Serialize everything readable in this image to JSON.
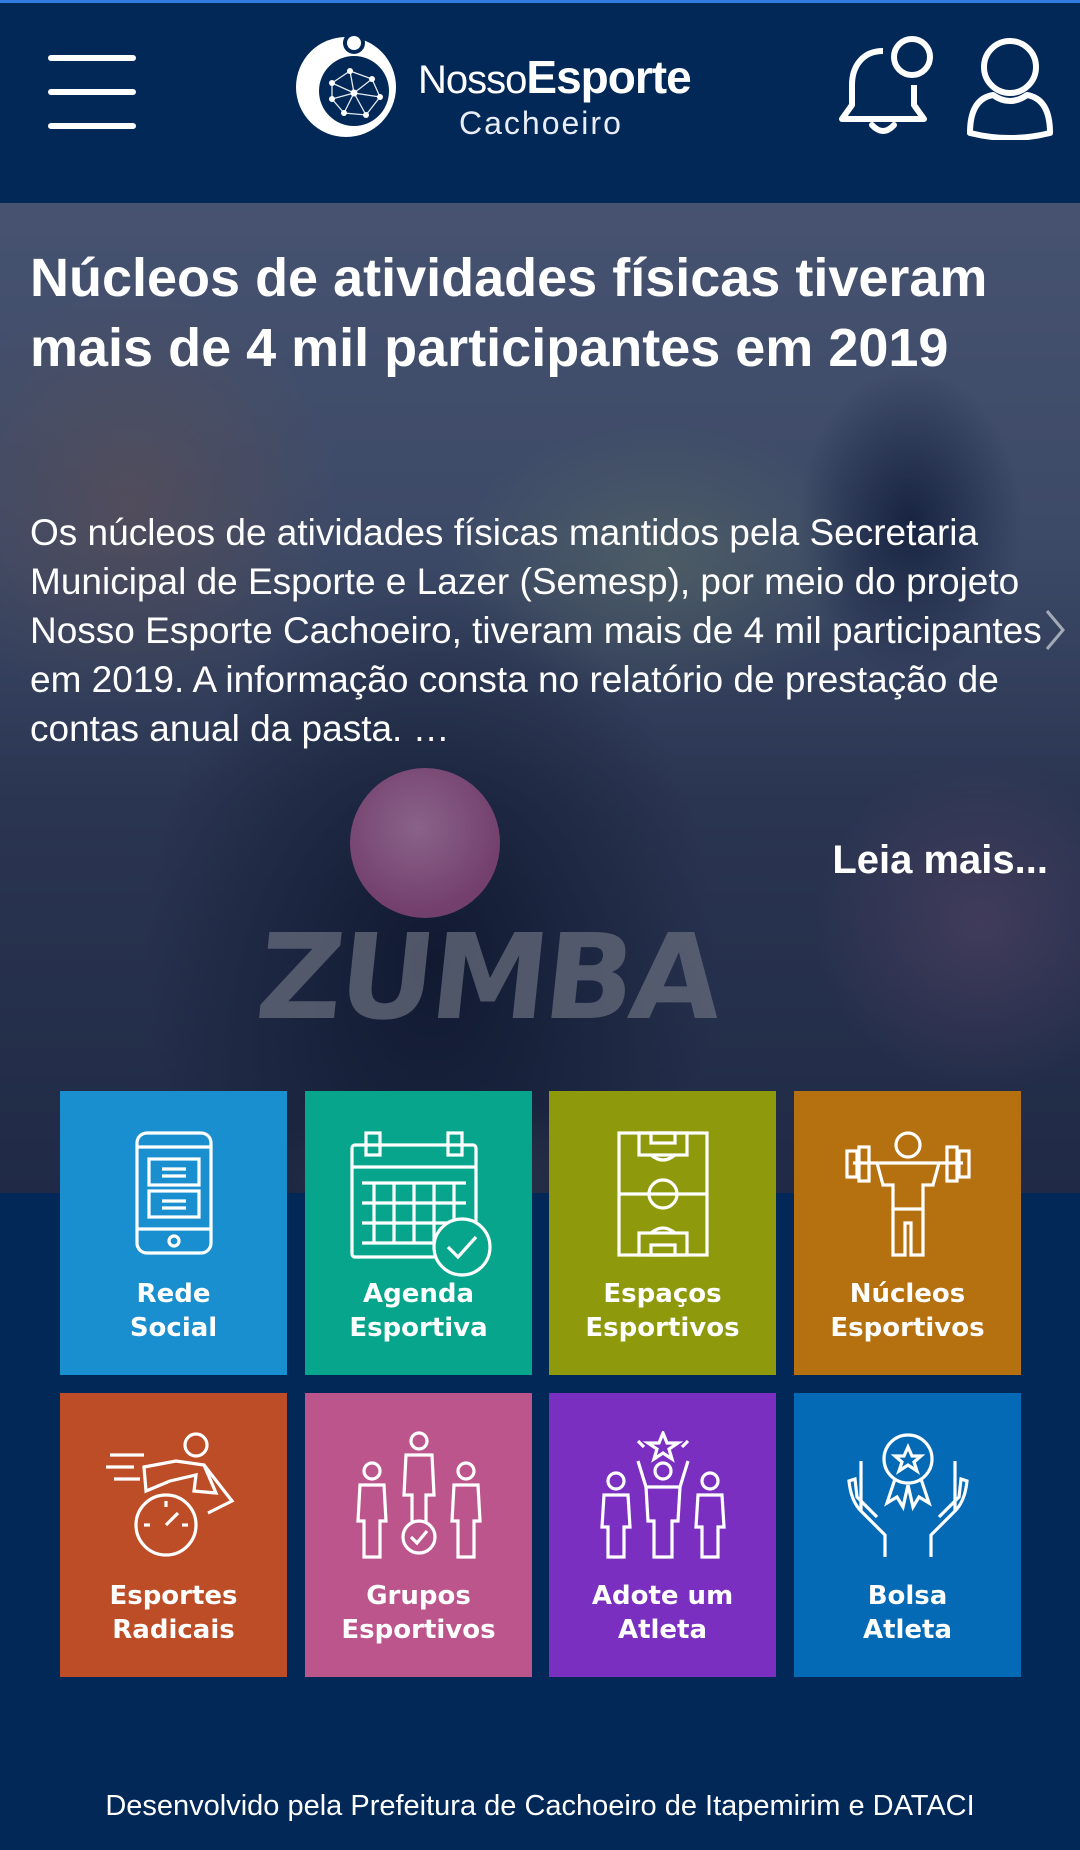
{
  "header": {
    "logo": {
      "line1_light": "Nosso",
      "line1_bold": "Esporte",
      "line2": "Cachoeiro"
    },
    "menu_icon": "hamburger-menu-icon",
    "notification_icon": "bell-icon",
    "profile_icon": "user-icon"
  },
  "hero": {
    "title": "Núcleos de atividades físicas tiveram mais de 4 mil participantes em 2019",
    "text": "Os núcleos de atividades físicas mantidos pela Secretaria Municipal de Esporte e Lazer (Semesp), por meio do projeto Nosso Esporte Cachoeiro, tiveram mais de 4 mil participantes em 2019. A informação consta no relatório de prestação de contas anual da pasta. …",
    "read_more": "Leia mais...",
    "next_icon": "chevron-right-icon",
    "photo_text": "ZUMBA"
  },
  "tiles": [
    {
      "label": "Rede\nSocial",
      "color": "#1a8fcf",
      "icon": "smartphone-icon"
    },
    {
      "label": "Agenda\nEsportiva",
      "color": "#07a68c",
      "icon": "calendar-check-icon"
    },
    {
      "label": "Espaços\nEsportivos",
      "color": "#8e9a0c",
      "icon": "football-field-icon"
    },
    {
      "label": "Núcleos\nEsportivos",
      "color": "#b5700f",
      "icon": "weightlifter-icon"
    },
    {
      "label": "Esportes\nRadicais",
      "color": "#bd4d27",
      "icon": "speed-runner-icon"
    },
    {
      "label": "Grupos\nEsportivos",
      "color": "#bd558d",
      "icon": "group-check-icon"
    },
    {
      "label": "Adote um\nAtleta",
      "color": "#7a2fc1",
      "icon": "cheering-group-icon"
    },
    {
      "label": "Bolsa\nAtleta",
      "color": "#056ab5",
      "icon": "medal-hands-icon"
    }
  ],
  "footer": {
    "text": "Desenvolvido pela Prefeitura de Cachoeiro de Itapemirim e DATACI"
  }
}
